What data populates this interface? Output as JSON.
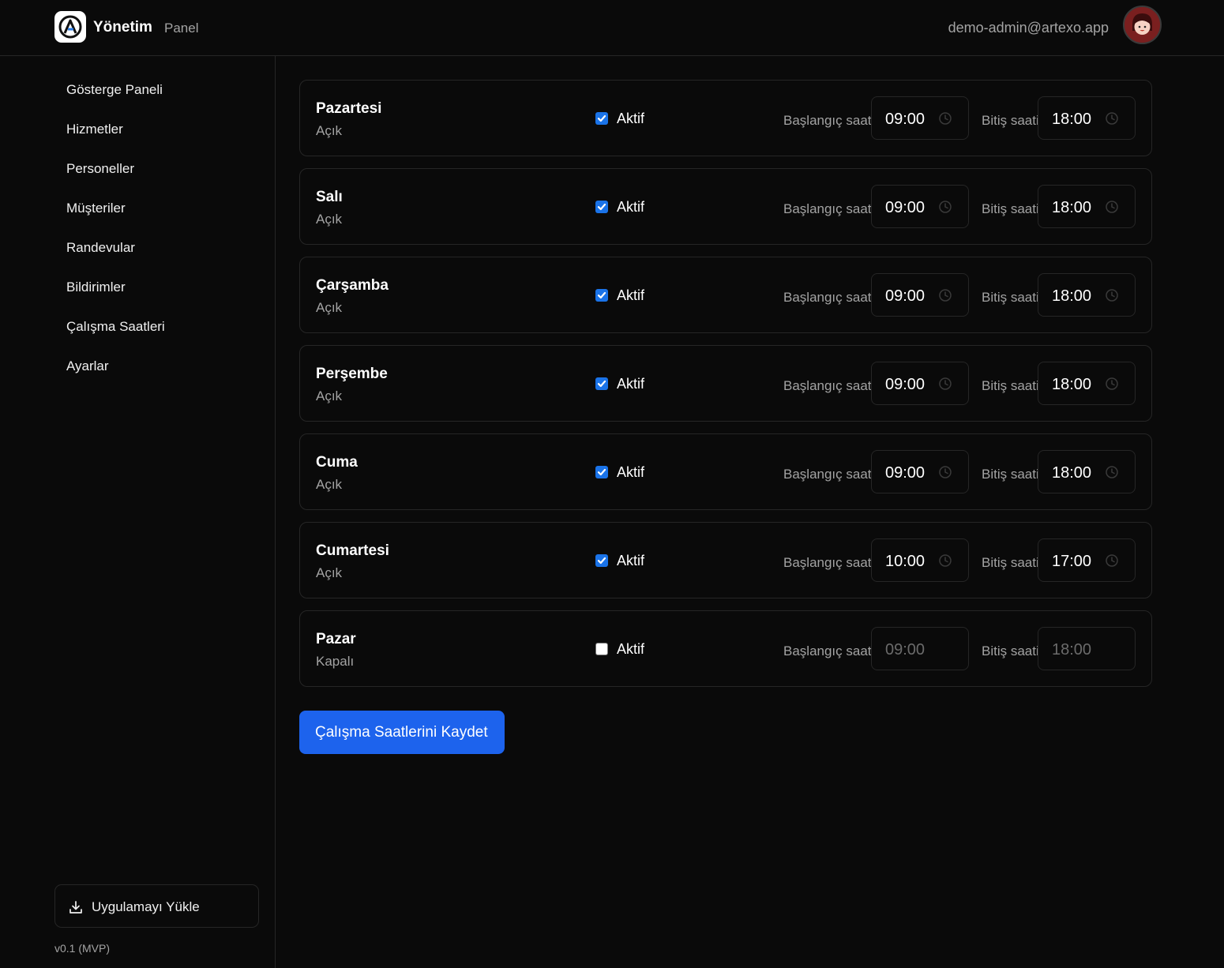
{
  "header": {
    "brand": "Yönetim",
    "brand_sub": "Panel",
    "user_email": "demo-admin@artexo.app"
  },
  "sidebar": {
    "items": [
      {
        "label": "Gösterge Paneli"
      },
      {
        "label": "Hizmetler"
      },
      {
        "label": "Personeller"
      },
      {
        "label": "Müşteriler"
      },
      {
        "label": "Randevular"
      },
      {
        "label": "Bildirimler"
      },
      {
        "label": "Çalışma Saatleri"
      },
      {
        "label": "Ayarlar"
      }
    ],
    "install_label": "Uygulamayı Yükle",
    "version": "v0.1 (MVP)"
  },
  "labels": {
    "active": "Aktif",
    "start_time": "Başlangıç saati",
    "end_time": "Bitiş saati"
  },
  "days": [
    {
      "name": "Pazartesi",
      "status": "Açık",
      "active": true,
      "start": "09:00",
      "end": "18:00"
    },
    {
      "name": "Salı",
      "status": "Açık",
      "active": true,
      "start": "09:00",
      "end": "18:00"
    },
    {
      "name": "Çarşamba",
      "status": "Açık",
      "active": true,
      "start": "09:00",
      "end": "18:00"
    },
    {
      "name": "Perşembe",
      "status": "Açık",
      "active": true,
      "start": "09:00",
      "end": "18:00"
    },
    {
      "name": "Cuma",
      "status": "Açık",
      "active": true,
      "start": "09:00",
      "end": "18:00"
    },
    {
      "name": "Cumartesi",
      "status": "Açık",
      "active": true,
      "start": "10:00",
      "end": "17:00"
    },
    {
      "name": "Pazar",
      "status": "Kapalı",
      "active": false,
      "start": "09:00",
      "end": "18:00"
    }
  ],
  "save_label": "Çalışma Saatlerini Kaydet",
  "colors": {
    "background": "#0a0a0a",
    "border": "#262626",
    "accent": "#1d63ed",
    "muted_text": "#a3a3a3"
  },
  "icons": {
    "logo": "artexo-logo-icon",
    "avatar": "user-avatar-icon",
    "install": "download-icon",
    "clock": "clock-icon",
    "check": "checkmark-icon"
  }
}
